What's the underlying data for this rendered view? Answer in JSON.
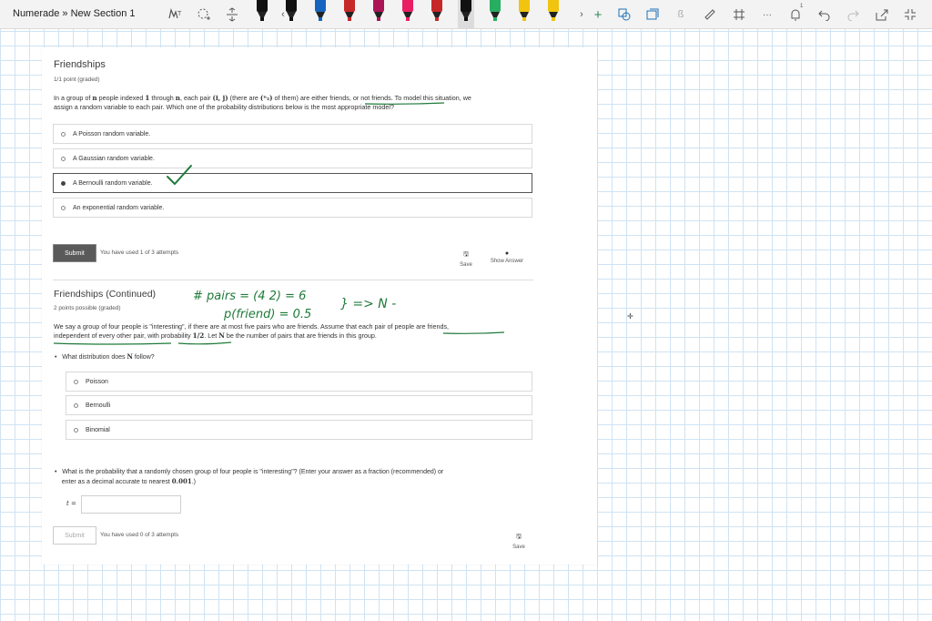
{
  "app": {
    "title": "Numerade » New Section 1"
  },
  "toolbar": {
    "icons": [
      "lasso-select-icon",
      "add-shape-icon",
      "add-space-icon",
      "pen-tools",
      "more-pens-left-icon",
      "more-pens-right-icon",
      "add-pen-icon",
      "ink-to-shape-icon",
      "ink-to-text-icon",
      "ink-math-icon",
      "ruler-icon",
      "grid-icon",
      "more-icon",
      "notification-icon",
      "undo-icon",
      "redo-icon",
      "share-icon",
      "fullscreen-icon"
    ],
    "more_label": "···",
    "notification_badge": "1",
    "pen_colors": [
      "#111111",
      "#111111",
      "#1565c0",
      "#c62828",
      "#ad1457",
      "#e91e63",
      "#c62828",
      "#111111",
      "#27ae60",
      "#f1c40f",
      "#f1c40f",
      "#8e44ad"
    ]
  },
  "q1": {
    "title": "Friendships",
    "points": "1/1 point (graded)",
    "prompt_a": "In a group of ",
    "prompt_n": "n",
    "prompt_b": " people indexed ",
    "prompt_1": "1",
    "prompt_c": " through ",
    "prompt_n2": "n",
    "prompt_d": ", each pair ",
    "prompt_ij": "(i, j)",
    "prompt_e": " (there are ",
    "prompt_binom": "(ⁿ₂)",
    "prompt_f": " of them) are either friends, or not friends. To model this situation, we",
    "prompt_line2": "assign a random variable to each pair. Which one of the probability distributions below is the most appropriate model?",
    "options": [
      "A Poisson random variable.",
      "A Gaussian random variable.",
      "A Bernoulli random variable.",
      "An exponential random variable."
    ],
    "selected_index": 2,
    "submit_label": "Submit",
    "attempts": "You have used 1 of 3 attempts",
    "save_label": "Save",
    "show_answer_label": "Show Answer"
  },
  "q2": {
    "title": "Friendships (Continued)",
    "points": "2 points possible (graded)",
    "line1": "We say a group of four people is \"interesting\", if there are at most five pairs who are friends. Assume that each pair of people are friends,",
    "line2a": "independent of every other pair, with probability ",
    "line2_half": "1/2",
    "line2b": ". Let ",
    "line2_N": "N",
    "line2c": " be the number of pairs that are friends in this group.",
    "sub1_a": "What distribution does ",
    "sub1_N": "N",
    "sub1_b": " follow?",
    "options": [
      "Poisson",
      "Bernoulli",
      "Binomial"
    ],
    "sub2_line1": "What is the probability that a randomly chosen group of four people is \"interesting\"? (Enter your answer as a fraction (recommended) or",
    "sub2_line2a": "enter as a decimal accurate to nearest ",
    "sub2_precision": "0.001",
    "sub2_line2b": ".)",
    "answer_label": "t =",
    "answer_value": "",
    "submit_label": "Submit",
    "attempts": "You have used 0 of 3 attempts",
    "save_label": "Save"
  },
  "ink": {
    "checkmark_color": "#1f7a3a",
    "annotation_color": "#1f7a3a",
    "line1": "# pairs = (4 2) = 6",
    "line2": "p(friend) = 0.5",
    "arrow": "} => N -"
  }
}
